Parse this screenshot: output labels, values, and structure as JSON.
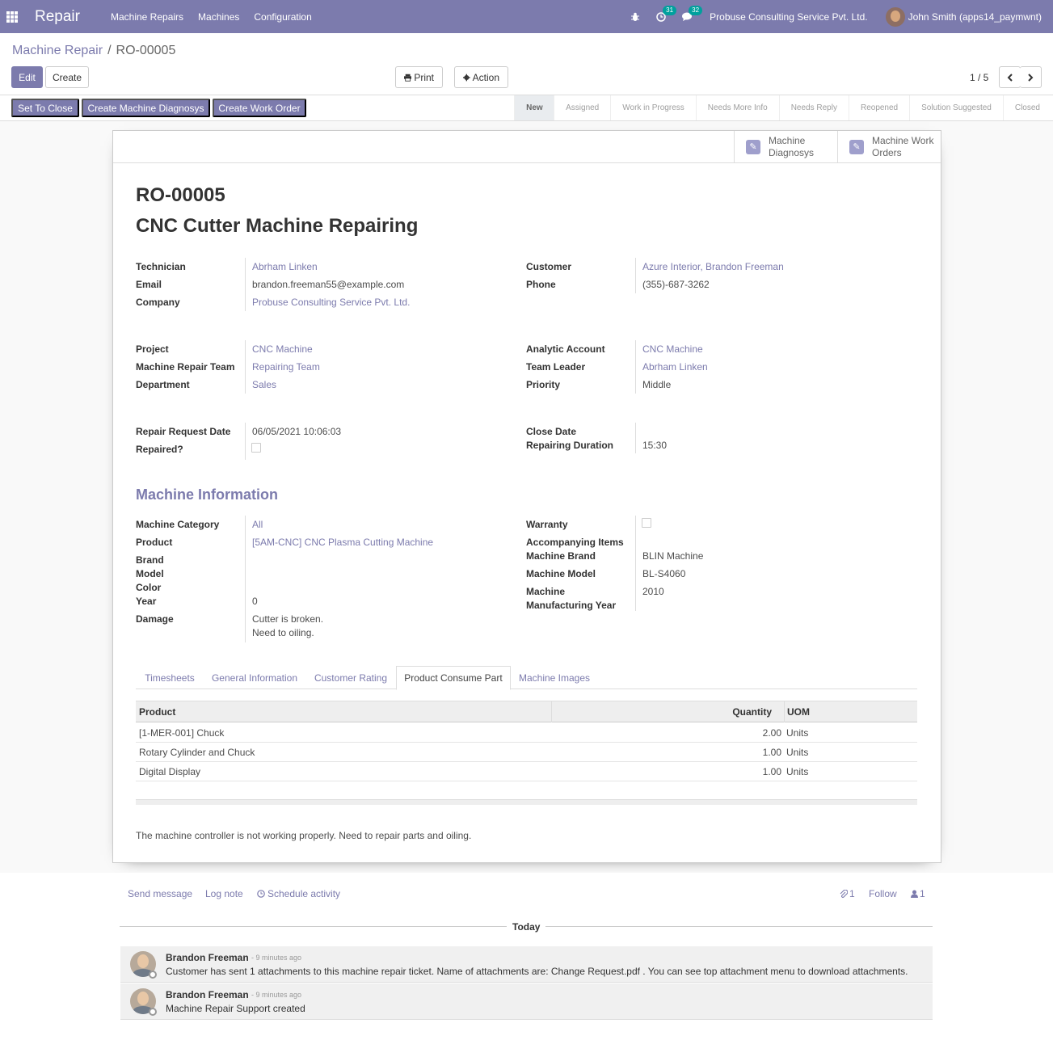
{
  "navbar": {
    "brand": "Repair",
    "menu": [
      "Machine Repairs",
      "Machines",
      "Configuration"
    ],
    "activity_count": "31",
    "message_count": "32",
    "company": "Probuse Consulting Service Pvt. Ltd.",
    "user": "John Smith (apps14_paymwnt)"
  },
  "breadcrumb": {
    "parent": "Machine Repair",
    "separator": "/",
    "current": "RO-00005"
  },
  "buttons": {
    "edit": "Edit",
    "create": "Create",
    "print": "Print",
    "action": "Action"
  },
  "pager": {
    "value": "1 / 5"
  },
  "statusbar": {
    "buttons": [
      "Set To Close",
      "Create Machine Diagnosys",
      "Create Work Order"
    ],
    "stages": [
      "New",
      "Assigned",
      "Work in Progress",
      "Needs More Info",
      "Needs Reply",
      "Reopened",
      "Solution Suggested",
      "Closed"
    ],
    "active_stage": "New"
  },
  "smart_buttons": {
    "diagnosys": {
      "line1": "Machine",
      "line2": "Diagnosys"
    },
    "work_orders": {
      "line1": "Machine Work",
      "line2": "Orders"
    }
  },
  "record": {
    "code": "RO-00005",
    "name": "CNC Cutter Machine Repairing"
  },
  "fields": {
    "technician": {
      "label": "Technician",
      "value": "Abrham Linken"
    },
    "email": {
      "label": "Email",
      "value": "brandon.freeman55@example.com"
    },
    "company": {
      "label": "Company",
      "value": "Probuse Consulting Service Pvt. Ltd."
    },
    "customer": {
      "label": "Customer",
      "value": "Azure Interior, Brandon Freeman"
    },
    "phone": {
      "label": "Phone",
      "value": "(355)-687-3262"
    },
    "project": {
      "label": "Project",
      "value": "CNC Machine"
    },
    "repair_team": {
      "label": "Machine Repair Team",
      "value": "Repairing Team"
    },
    "department": {
      "label": "Department",
      "value": "Sales"
    },
    "analytic_account": {
      "label": "Analytic Account",
      "value": "CNC Machine"
    },
    "team_leader": {
      "label": "Team Leader",
      "value": "Abrham Linken"
    },
    "priority": {
      "label": "Priority",
      "value": "Middle"
    },
    "request_date": {
      "label": "Repair Request Date",
      "value": "06/05/2021 10:06:03"
    },
    "repaired": {
      "label": "Repaired?"
    },
    "close_date": {
      "label": "Close Date"
    },
    "duration": {
      "label": "Repairing Duration",
      "value": "15:30"
    }
  },
  "machine_info": {
    "title": "Machine Information",
    "category": {
      "label": "Machine Category",
      "value": "All"
    },
    "product": {
      "label": "Product",
      "value": "[5AM-CNC] CNC Plasma Cutting Machine"
    },
    "brand": {
      "label": "Brand"
    },
    "model": {
      "label": "Model"
    },
    "color": {
      "label": "Color"
    },
    "year": {
      "label": "Year",
      "value": "0"
    },
    "damage": {
      "label": "Damage",
      "line1": "Cutter is broken.",
      "line2": "Need to oiling."
    },
    "warranty": {
      "label": "Warranty"
    },
    "accompanying": {
      "label": "Accompanying Items"
    },
    "machine_brand": {
      "label": "Machine Brand",
      "value": "BLIN Machine"
    },
    "machine_model": {
      "label": "Machine Model",
      "value": "BL-S4060"
    },
    "manufacturing_year": {
      "label1": "Machine",
      "label2": "Manufacturing Year",
      "value": "2010"
    }
  },
  "tabs": [
    "Timesheets",
    "General Information",
    "Customer Rating",
    "Product Consume Part",
    "Machine Images"
  ],
  "active_tab": "Product Consume Part",
  "parts_table": {
    "headers": [
      "Product",
      "Quantity",
      "UOM"
    ],
    "rows": [
      [
        "[1-MER-001] Chuck",
        "2.00",
        "Units"
      ],
      [
        "Rotary Cylinder and Chuck",
        "1.00",
        "Units"
      ],
      [
        "Digital Display",
        "1.00",
        "Units"
      ]
    ]
  },
  "note": "The machine controller is not working properly. Need to repair parts and oiling.",
  "chatter": {
    "send_message": "Send message",
    "log_note": "Log note",
    "schedule_activity": "Schedule activity",
    "attachments": "1",
    "follow": "Follow",
    "followers": "1",
    "today": "Today",
    "messages": [
      {
        "author": "Brandon Freeman",
        "date": "- 9 minutes ago",
        "body": "Customer has sent 1 attachments to this machine repair ticket. Name of attachments are: Change Request.pdf . You can see top attachment menu to download attachments."
      },
      {
        "author": "Brandon Freeman",
        "date": "- 9 minutes ago",
        "body": "Machine Repair Support created"
      }
    ]
  },
  "colors": {
    "brand": "#7c7bad",
    "badge": "#00a09d"
  }
}
